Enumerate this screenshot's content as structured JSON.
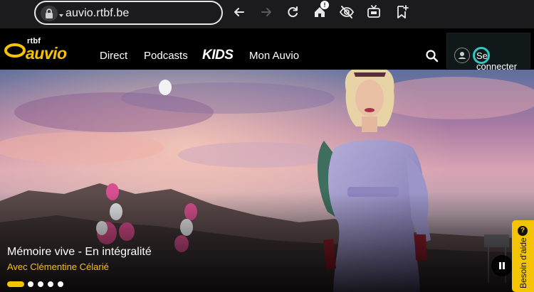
{
  "browser": {
    "url": "auvio.rtbf.be",
    "icons": [
      "lock-icon",
      "back-arrow-icon",
      "forward-arrow-icon",
      "reload-icon",
      "home-icon",
      "eye-off-icon",
      "tv-icon",
      "bookmark-add-icon"
    ],
    "home_badge": "!"
  },
  "header": {
    "logo_small": "rtbf",
    "logo_main": "auvio",
    "nav": [
      "Direct",
      "Podcasts",
      "KIDS",
      "Mon Auvio"
    ],
    "login_label": "Se connecter",
    "colors": {
      "brand_yellow": "#f5c400",
      "accent_teal": "#2dc9c6",
      "background": "#000000"
    }
  },
  "hero": {
    "title": "Mémoire vive - En intégralité",
    "subtitle": "Avec Clémentine Célarié",
    "carousel_dots": 5,
    "active_dot": 0,
    "help_label": "Besoin d'aide",
    "help_icon": "?"
  }
}
